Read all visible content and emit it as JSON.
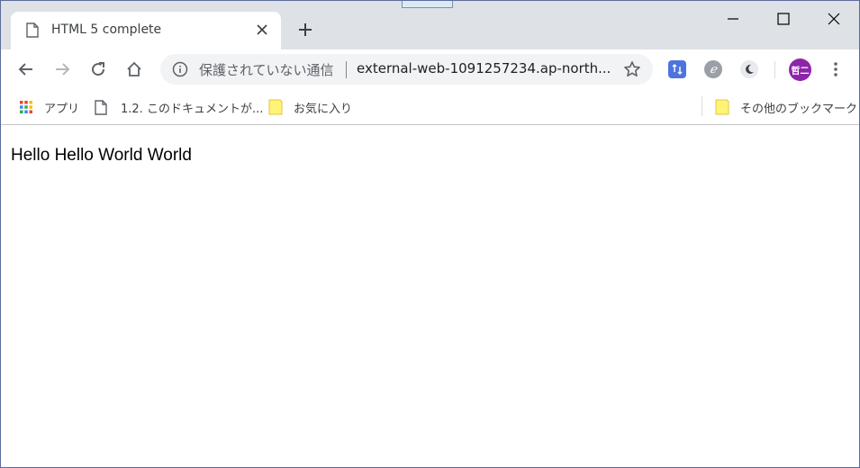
{
  "tab": {
    "title": "HTML 5 complete"
  },
  "omnibox": {
    "security_label": "保護されていない通信",
    "url": "external-web-1091257234.ap-north..."
  },
  "extensions": [
    {
      "icon": "translate-extension-icon",
      "color": "#4e73df"
    },
    {
      "icon": "evernote-extension-icon",
      "color": "#9aa0a6"
    },
    {
      "icon": "dark-mode-extension-icon",
      "color": "#5f6368"
    }
  ],
  "profile": {
    "initials": "哲二",
    "color": "#8e24aa"
  },
  "bookmarks": {
    "apps_label": "アプリ",
    "items": [
      {
        "label": "1.2. このドキュメントが..."
      },
      {
        "label": "お気に入り"
      }
    ],
    "other_label": "その他のブックマーク"
  },
  "page": {
    "text": "Hello Hello World World"
  }
}
